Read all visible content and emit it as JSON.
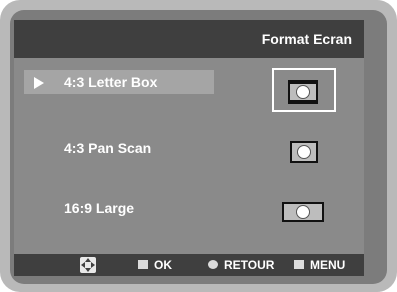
{
  "header": {
    "title": "Format Ecran"
  },
  "options": [
    {
      "label": "4:3 Letter Box",
      "selected": true,
      "icon": "letterbox-screen-icon"
    },
    {
      "label": "4:3 Pan Scan",
      "selected": false,
      "icon": "panscan-screen-icon"
    },
    {
      "label": "16:9 Large",
      "selected": false,
      "icon": "widescreen-icon"
    }
  ],
  "footer": {
    "navigate_icon": "navigation-arrows-icon",
    "ok_label": "OK",
    "ok_icon": "enter-icon",
    "return_label": "RETOUR",
    "return_icon": "return-icon",
    "menu_label": "MENU",
    "menu_icon": "menu-icon"
  },
  "colors": {
    "frame": "#b9b9b9",
    "background": "#7c7c7c",
    "header": "#3f3f3f",
    "panel": "#8a8a8a",
    "highlight": "#a5a5a5",
    "text": "#ffffff"
  }
}
